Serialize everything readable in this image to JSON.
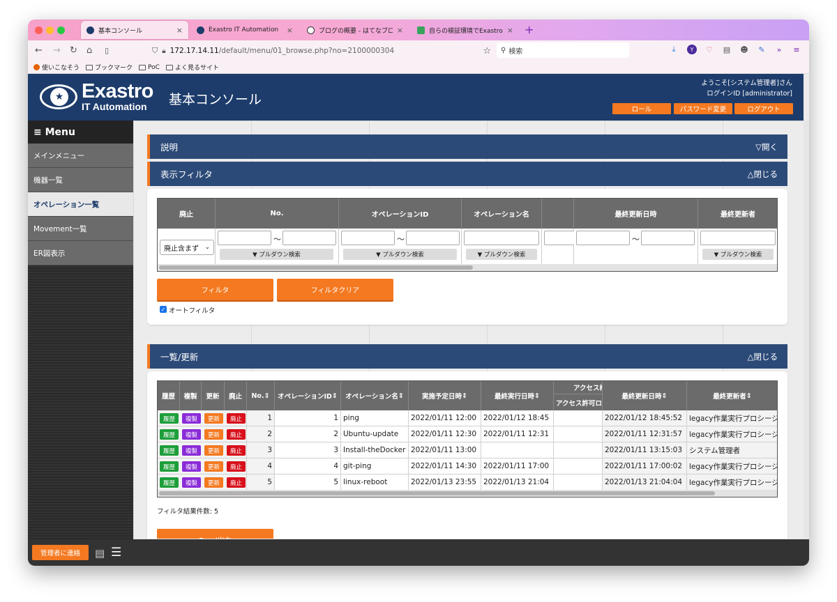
{
  "browser": {
    "tabs": [
      {
        "label": "基本コンソール",
        "close": "×"
      },
      {
        "label": "Exastro IT Automation",
        "close": "×"
      },
      {
        "label": "ブログの概要 - はてなブログ",
        "close": "×"
      },
      {
        "label": "自らの検証環境でExastro ITAを利",
        "close": "×"
      }
    ],
    "new_tab": "+",
    "url_host": "172.17.14.11",
    "url_path": "/default/menu/01_browse.php?no=2100000304",
    "search_placeholder": "検索",
    "bookmarks": [
      "使いこなそう",
      "ブックマーク",
      "PoC",
      "よく見るサイト"
    ]
  },
  "header": {
    "logo_text": "Exastro",
    "logo_sub": "IT Automation",
    "title": "基本コンソール",
    "welcome": "ようこそ[システム管理者]さん",
    "login_id": "ログインID [administrator]",
    "buttons": [
      "ロール",
      "パスワード変更",
      "ログアウト"
    ]
  },
  "sidebar": {
    "menu_label": "≡ Menu",
    "items": [
      {
        "label": "メインメニュー"
      },
      {
        "label": "機器一覧"
      },
      {
        "label": "オペレーション一覧"
      },
      {
        "label": "Movement一覧"
      },
      {
        "label": "ER図表示"
      }
    ]
  },
  "sections": {
    "description": {
      "title": "説明",
      "toggle": "▽開く"
    },
    "filter": {
      "title": "表示フィルタ",
      "toggle": "△閉じる"
    },
    "list": {
      "title": "一覧/更新",
      "toggle": "△閉じる"
    }
  },
  "filter": {
    "headers": [
      "廃止",
      "No.",
      "オペレーションID",
      "オペレーション名",
      "",
      "最終更新日時",
      "最終更新者"
    ],
    "discard_select": "廃止含まず",
    "tilde": "〜",
    "pulldown_label": "▼ プルダウン検索",
    "filter_button": "フィルタ",
    "clear_button": "フィルタクリア",
    "auto_filter_label": "オートフィルタ",
    "auto_filter_checked": true
  },
  "list": {
    "headers": {
      "history": "履歴",
      "copy": "複製",
      "update": "更新",
      "discard": "廃止",
      "no": "No.",
      "operation_id": "オペレーションID",
      "operation_name": "オペレーション名",
      "scheduled": "実施予定日時",
      "last_exec": "最終実行日時",
      "access_group": "アクセス権",
      "access_role": "アクセス許可ロール",
      "updated_at": "最終更新日時",
      "updated_by": "最終更新者"
    },
    "sort_icon": "⇕",
    "row_buttons": {
      "history": "履歴",
      "copy": "複製",
      "update": "更新",
      "discard": "廃止"
    },
    "rows": [
      {
        "no": "1",
        "op_id": "1",
        "op_name": "ping",
        "scheduled": "2022/01/11 12:00",
        "last_exec": "2022/01/12 18:45",
        "access": "",
        "updated_at": "2022/01/12 18:45:52",
        "updated_by": "legacy作業実行プロシージャ"
      },
      {
        "no": "2",
        "op_id": "2",
        "op_name": "Ubuntu-update",
        "scheduled": "2022/01/11 12:30",
        "last_exec": "2022/01/11 12:31",
        "access": "",
        "updated_at": "2022/01/11 12:31:57",
        "updated_by": "legacy作業実行プロシージャ"
      },
      {
        "no": "3",
        "op_id": "3",
        "op_name": "Install-theDocker",
        "scheduled": "2022/01/11 13:00",
        "last_exec": "",
        "access": "",
        "updated_at": "2022/01/11 13:15:03",
        "updated_by": "システム管理者"
      },
      {
        "no": "4",
        "op_id": "4",
        "op_name": "git-ping",
        "scheduled": "2022/01/11 14:30",
        "last_exec": "2022/01/11 17:00",
        "access": "",
        "updated_at": "2022/01/11 17:00:02",
        "updated_by": "legacy作業実行プロシージャ"
      },
      {
        "no": "5",
        "op_id": "5",
        "op_name": "linux-reboot",
        "scheduled": "2022/01/13 23:55",
        "last_exec": "2022/01/13 21:04",
        "access": "",
        "updated_at": "2022/01/13 21:04:04",
        "updated_by": "legacy作業実行プロシージャ"
      }
    ],
    "result_count": "フィルタ結果件数: 5",
    "excel_button": "Excel出力"
  },
  "footer": {
    "contact_button": "管理者に連絡"
  },
  "colors": {
    "header_bg": "#1d3c6b",
    "section_bar": "#2c4a78",
    "accent_orange": "#f47920",
    "history_green": "#1e9e3a",
    "copy_purple": "#8a2bd8",
    "update_orange": "#f47920",
    "discard_red": "#d8101a"
  }
}
